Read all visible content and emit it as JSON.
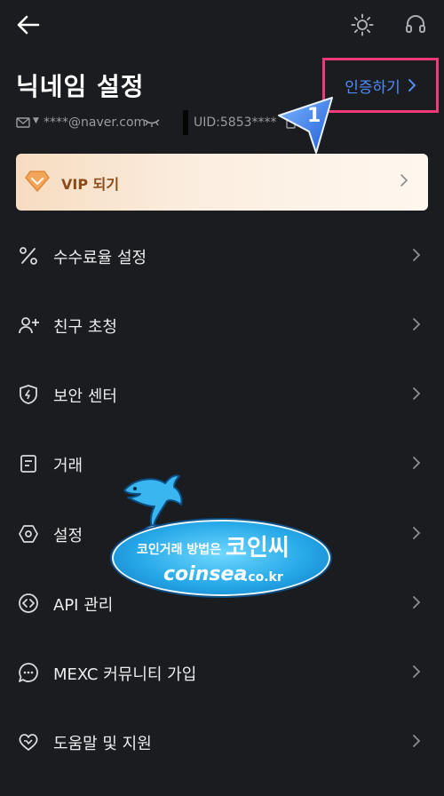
{
  "header": {
    "back_icon": "arrow-left-icon",
    "theme_icon": "sun-icon",
    "support_icon": "headset-icon"
  },
  "profile": {
    "title": "닉네임 설정",
    "verify_label": "인증하기",
    "email": "****@naver.com",
    "uid": "UID:5853****",
    "callout_number": "1"
  },
  "vip": {
    "label": "VIP 되기"
  },
  "menu": {
    "items": [
      {
        "label": "수수료율 설정",
        "icon": "percent-icon"
      },
      {
        "label": "친구 초청",
        "icon": "add-user-icon"
      },
      {
        "label": "보안 센터",
        "icon": "shield-icon"
      },
      {
        "label": "거래",
        "icon": "document-icon"
      },
      {
        "label": "설정",
        "icon": "hexagon-settings-icon"
      },
      {
        "label": "API 관리",
        "icon": "code-icon"
      },
      {
        "label": "MEXC 커뮤니티 가입",
        "icon": "chat-icon"
      },
      {
        "label": "도움말 및 지원",
        "icon": "heart-support-icon"
      }
    ]
  },
  "watermark": {
    "line1": "코인거래 방법은",
    "brand": "코인씨",
    "site": "coinsea",
    "domain": ".co.kr"
  },
  "colors": {
    "background": "#1b1c1f",
    "accent_blue": "#4f8cf7",
    "highlight_pink": "#f03a7a",
    "vip_text": "#8a4b18"
  }
}
